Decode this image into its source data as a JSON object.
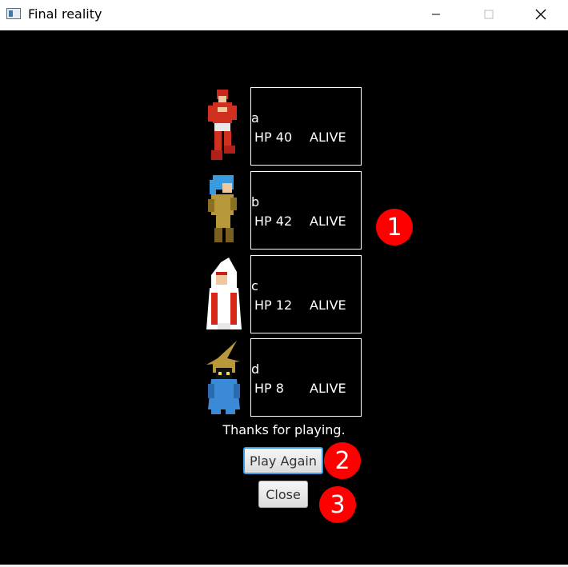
{
  "window": {
    "title": "Final reality"
  },
  "party": [
    {
      "name": "a",
      "hp_text": "HP 40",
      "status": "ALIVE",
      "sprite": "red-fighter-icon"
    },
    {
      "name": "b",
      "hp_text": "HP 42",
      "status": "ALIVE",
      "sprite": "thief-icon"
    },
    {
      "name": "c",
      "hp_text": "HP 12",
      "status": "ALIVE",
      "sprite": "white-mage-icon"
    },
    {
      "name": "d",
      "hp_text": "HP 8",
      "status": "ALIVE",
      "sprite": "black-mage-icon"
    }
  ],
  "end_screen": {
    "message": "Thanks for playing.",
    "play_again_label": "Play Again",
    "close_label": "Close"
  },
  "annotations": [
    "1",
    "2",
    "3"
  ],
  "colors": {
    "annotation": "#ff0000",
    "background": "#000000",
    "focus_ring": "#3c9ee6"
  }
}
